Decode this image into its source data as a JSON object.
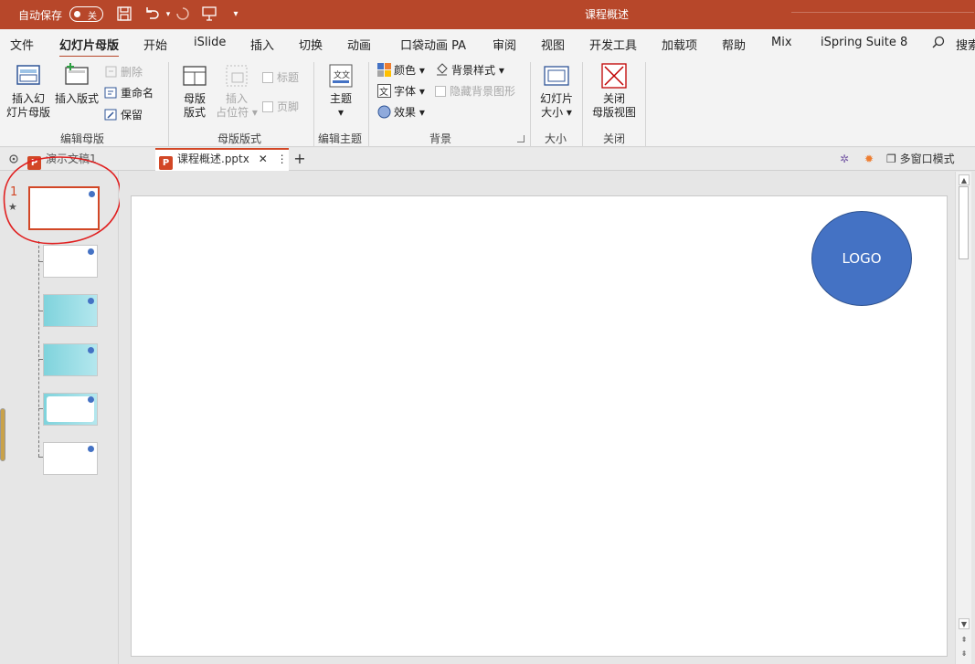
{
  "titlebar": {
    "autosave_label": "自动保存",
    "toggle_label": "关",
    "doc_title": "课程概述"
  },
  "tabs": [
    "文件",
    "幻灯片母版",
    "开始",
    "iSlide",
    "插入",
    "切换",
    "动画",
    "口袋动画 PA",
    "审阅",
    "视图",
    "开发工具",
    "加载项",
    "帮助",
    "Mix",
    "iSpring Suite 8",
    "搜索"
  ],
  "ribbon": {
    "edit_master": {
      "label": "编辑母版",
      "insert_slide_master": "插入幻灯片母版",
      "insert_slide_master_l1": "插入幻",
      "insert_slide_master_l2": "灯片母版",
      "insert_layout": "插入版式",
      "delete": "删除",
      "rename": "重命名",
      "preserve": "保留"
    },
    "master_layout": {
      "label": "母版版式",
      "master_layout_l1": "母版",
      "master_layout_l2": "版式",
      "insert_placeholder_l1": "插入",
      "insert_placeholder_l2": "占位符",
      "title_chk": "标题",
      "footer_chk": "页脚"
    },
    "edit_theme": {
      "label": "编辑主题",
      "themes": "主题"
    },
    "background": {
      "label": "背景",
      "colors": "颜色",
      "fonts": "字体",
      "effects": "效果",
      "bg_styles": "背景样式",
      "hide_bg": "隐藏背景图形"
    },
    "size": {
      "label": "大小",
      "slide_size_l1": "幻灯片",
      "slide_size_l2": "大小"
    },
    "close": {
      "label": "关闭",
      "close_l1": "关闭",
      "close_l2": "母版视图"
    }
  },
  "docbar": {
    "tab1": "演示文稿1",
    "tab2": "课程概述.pptx",
    "multi_window": "多窗口模式"
  },
  "thumbnails": {
    "master_number": "1",
    "star": "★"
  },
  "slide": {
    "logo_text": "LOGO"
  },
  "colors": {
    "accent": "#b7472a",
    "logo": "#4472c4",
    "annotation": "#e02020"
  },
  "icons": [
    "undo-icon",
    "redo-icon",
    "save-icon",
    "search-icon",
    "close-icon",
    "add-icon",
    "settings-icon"
  ]
}
